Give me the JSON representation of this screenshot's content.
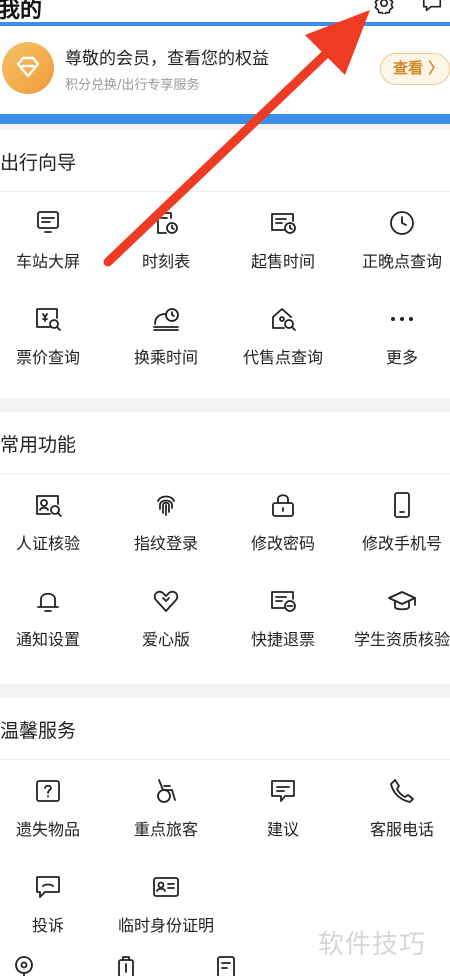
{
  "header": {
    "title": "我的"
  },
  "member": {
    "title": "尊敬的会员，查看您的权益",
    "subtitle": "积分兑换/出行专享服务",
    "view_label": "查看 〉"
  },
  "sections": [
    {
      "title": "出行向导",
      "items": [
        {
          "label": "车站大屏",
          "icon": "station-screen-icon"
        },
        {
          "label": "时刻表",
          "icon": "timetable-icon"
        },
        {
          "label": "起售时间",
          "icon": "sale-time-icon"
        },
        {
          "label": "正晚点查询",
          "icon": "clock-icon"
        },
        {
          "label": "票价查询",
          "icon": "fare-search-icon"
        },
        {
          "label": "换乘时间",
          "icon": "transfer-time-icon"
        },
        {
          "label": "代售点查询",
          "icon": "agency-search-icon"
        },
        {
          "label": "更多",
          "icon": "more-icon"
        }
      ]
    },
    {
      "title": "常用功能",
      "items": [
        {
          "label": "人证核验",
          "icon": "id-verify-icon"
        },
        {
          "label": "指纹登录",
          "icon": "fingerprint-icon"
        },
        {
          "label": "修改密码",
          "icon": "lock-icon"
        },
        {
          "label": "修改手机号",
          "icon": "phone-icon"
        },
        {
          "label": "通知设置",
          "icon": "bell-icon"
        },
        {
          "label": "爱心版",
          "icon": "heart-icon"
        },
        {
          "label": "快捷退票",
          "icon": "refund-ticket-icon"
        },
        {
          "label": "学生资质核验",
          "icon": "graduation-cap-icon"
        }
      ]
    },
    {
      "title": "温馨服务",
      "items": [
        {
          "label": "遗失物品",
          "icon": "lost-item-icon"
        },
        {
          "label": "重点旅客",
          "icon": "wheelchair-icon"
        },
        {
          "label": "建议",
          "icon": "suggestion-icon"
        },
        {
          "label": "客服电话",
          "icon": "phone-call-icon"
        },
        {
          "label": "投诉",
          "icon": "complaint-icon"
        },
        {
          "label": "临时身份证明",
          "icon": "temp-id-icon"
        }
      ]
    }
  ],
  "watermark": "软件技巧",
  "colors": {
    "accent_blue": "#3b8fe8",
    "annotation_red": "#ee3b24",
    "member_orange": "#ef9b3a"
  }
}
